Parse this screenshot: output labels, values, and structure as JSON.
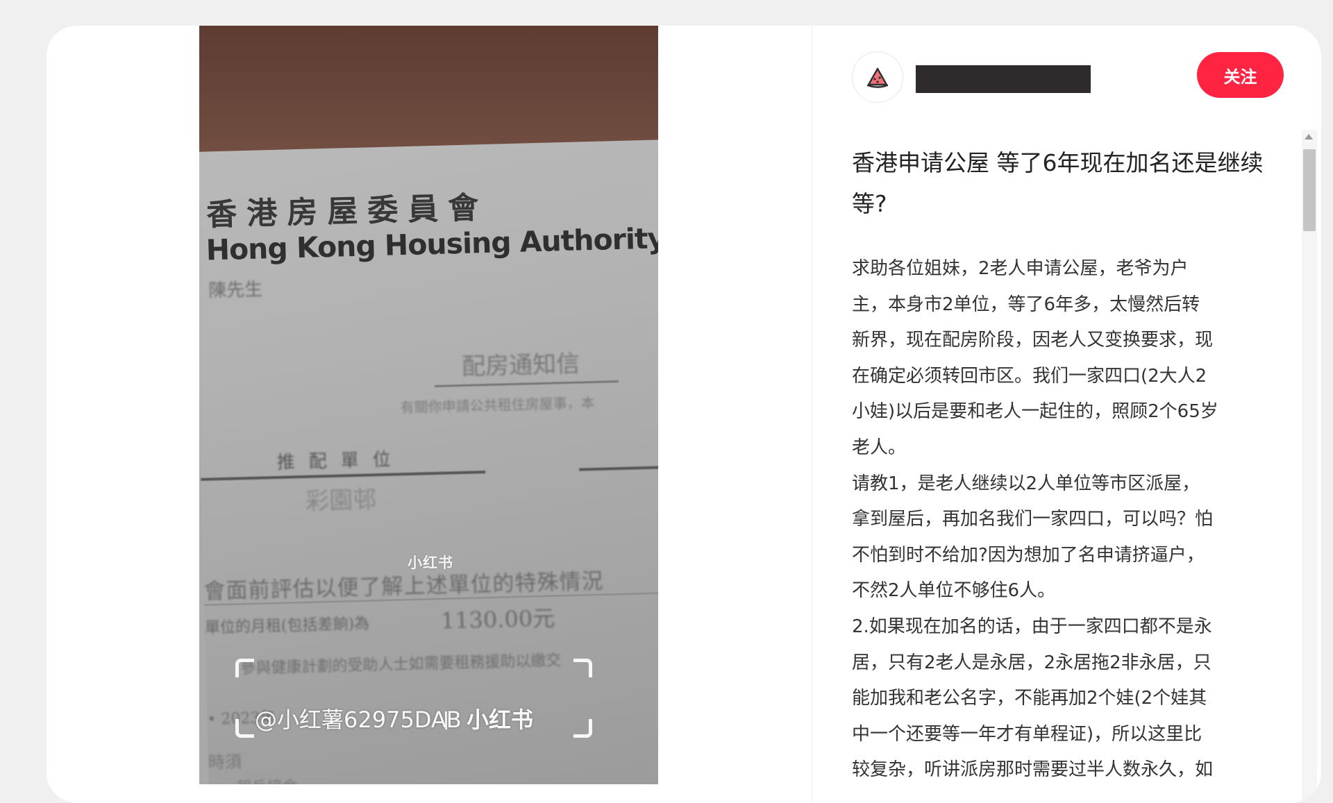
{
  "post": {
    "title": "香港申请公屋 等了6年现在加名还是继续等?",
    "body_lines": [
      "求助各位姐妹，2老人申请公屋，老爷为户",
      "主，本身市2单位，等了6年多，太慢然后转",
      "新界，现在配房阶段，因老人又变换要求，现",
      "在确定必须转回市区。我们一家四口(2大人2",
      "小娃)以后是要和老人一起住的，照顾2个65岁",
      "老人。",
      "请教1，是老人继续以2人单位等市区派屋，",
      "拿到屋后，再加名我们一家四口，可以吗？怕",
      "不怕到时不给加?因为想加了名申请挤逼户，",
      "不然2人单位不够住6人。",
      "2.如果现在加名的话，由于一家四口都不是永",
      "居，只有2老人是永居，2永居拖2非永居，只",
      "能加我和老公名字，不能再加2个娃(2个娃其",
      "中一个还要等一年才有单程证)，所以这里比",
      "较复杂，听讲派房那时需要过半人数永久，如"
    ]
  },
  "author": {
    "avatar_icon": "watermelon-icon",
    "follow_label": "关注"
  },
  "image": {
    "doc_title_cn": "香港房屋委員會",
    "doc_title_en": "Hong Kong Housing Authority",
    "doc_addressee": "陳先生",
    "doc_notice": "配房通知信",
    "doc_small1": "有關你申請公共租住房屋事，本",
    "doc_mid": "推配單位",
    "doc_dept": "彩園邨",
    "doc_body1": "會面前評估以便了解上述單位的特殊情況",
    "doc_body2": "單位的月租(包括差餉)為",
    "doc_amount": "1130.00元",
    "doc_body3": "參與健康計劃的受助人士如需要租務援助以繳交",
    "doc_body4": "• 2023年",
    "doc_body5": "時須",
    "doc_body6": "租戶接金",
    "watermark_center": "小红书",
    "watermark_handle": "@小红薯62975DAB",
    "watermark_logo": "小红书"
  },
  "colors": {
    "accent": "#ff2442",
    "redaction": "#2f2a2b"
  }
}
